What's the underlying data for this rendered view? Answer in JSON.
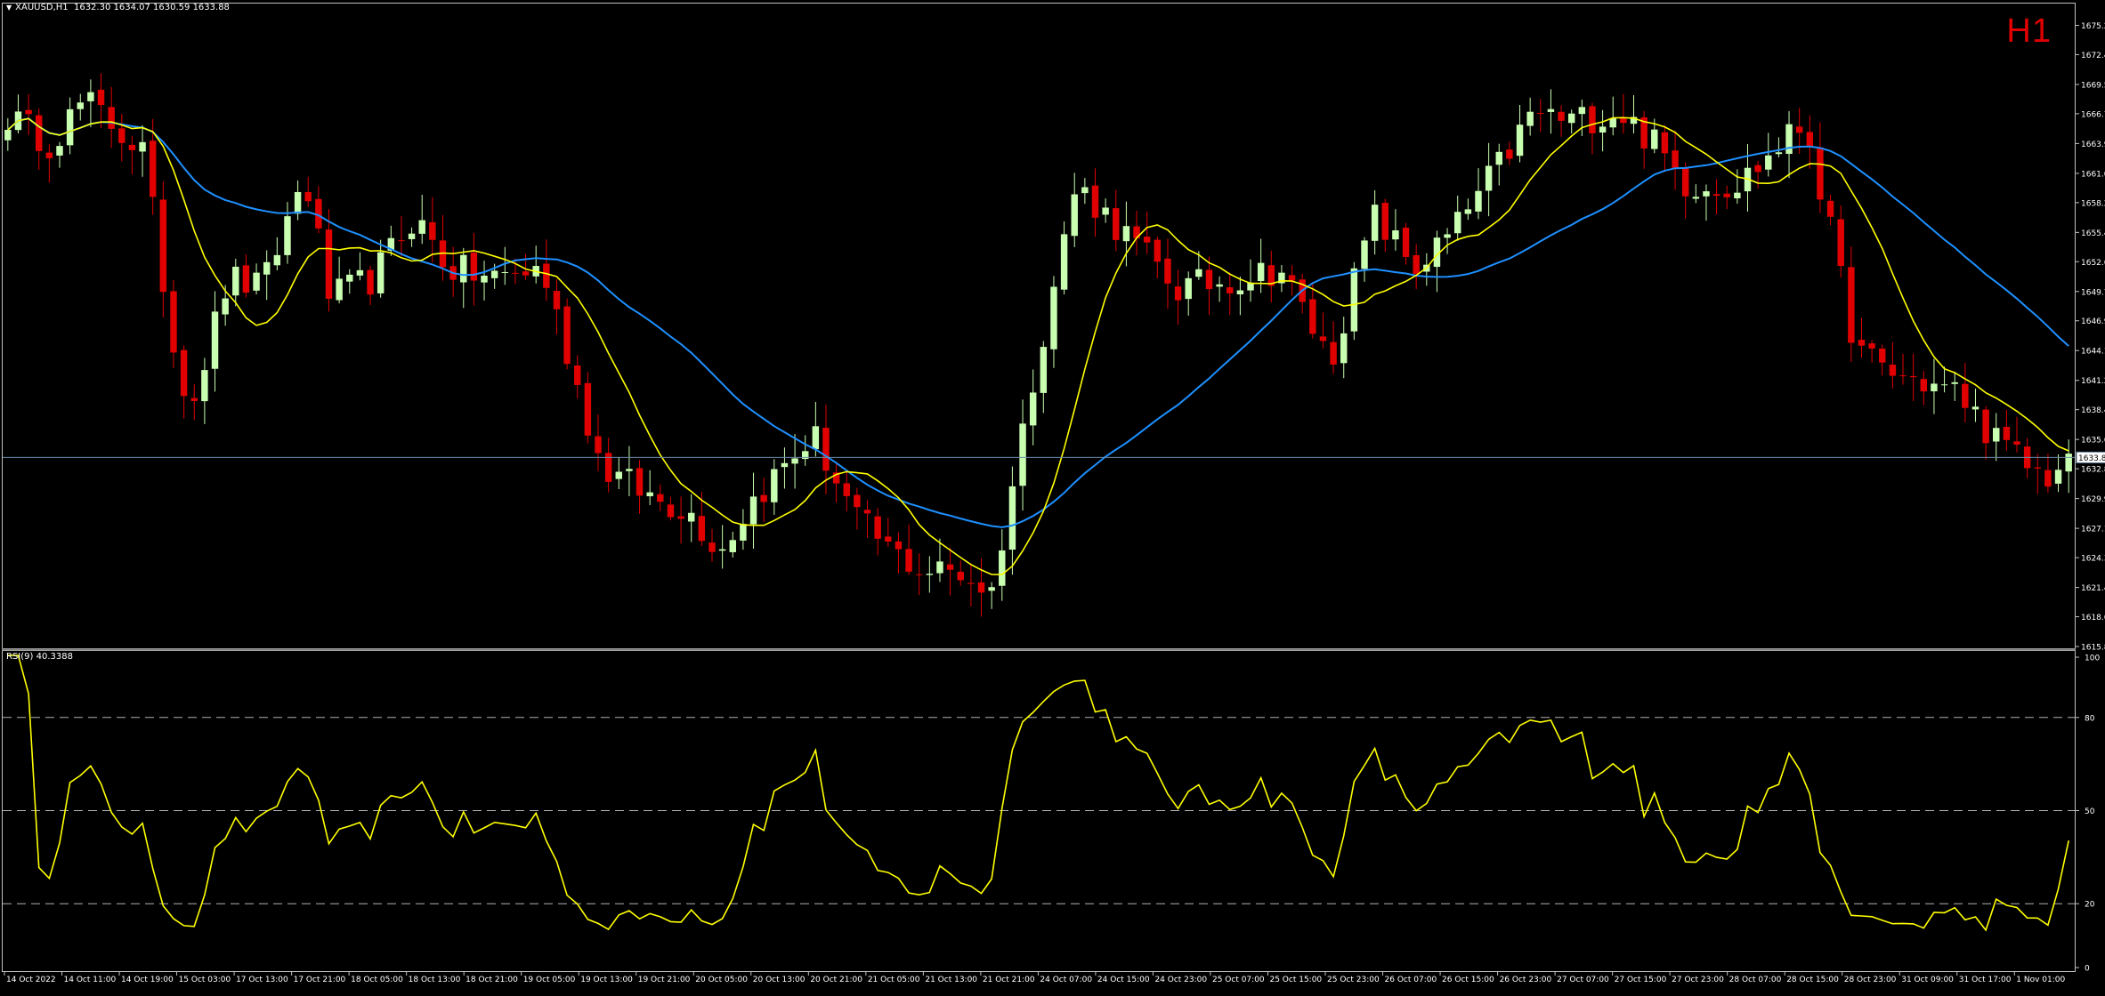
{
  "header": {
    "symbol": "XAUUSD,H1",
    "ohlc": "1632.30 1634.07 1630.59 1633.88"
  },
  "timeframe_badge": "H1",
  "rsi_label": "RSI(9) 40.3388",
  "colors": {
    "bull": "#c8ffb0",
    "bear": "#e00000",
    "ma_fast": "#ffff00",
    "ma_slow": "#1e90ff",
    "rsi": "#ffff00",
    "bid_line": "#6a8aa8"
  },
  "price_axis": {
    "min": 1615.8,
    "max": 1677.2,
    "ticks": [
      "1675.20",
      "1672.40",
      "1669.55",
      "1666.75",
      "1663.90",
      "1661.05",
      "1658.25",
      "1655.40",
      "1652.60",
      "1649.75",
      "1646.95",
      "1644.10",
      "1641.25",
      "1638.45",
      "1635.60",
      "1632.80",
      "1629.95",
      "1627.10",
      "1624.30",
      "1621.45",
      "1618.65",
      "1615.80"
    ],
    "bid": "1633.88"
  },
  "rsi_axis": {
    "ticks": [
      "100",
      "80",
      "50",
      "20",
      "0"
    ],
    "levels": [
      20,
      50,
      80
    ]
  },
  "time_axis": {
    "labels": [
      "14 Oct 2022",
      "14 Oct 11:00",
      "14 Oct 19:00",
      "15 Oct 03:00",
      "17 Oct 13:00",
      "17 Oct 21:00",
      "18 Oct 05:00",
      "18 Oct 13:00",
      "18 Oct 21:00",
      "19 Oct 05:00",
      "19 Oct 13:00",
      "19 Oct 21:00",
      "20 Oct 05:00",
      "20 Oct 13:00",
      "20 Oct 21:00",
      "21 Oct 05:00",
      "21 Oct 13:00",
      "21 Oct 21:00",
      "24 Oct 07:00",
      "24 Oct 15:00",
      "24 Oct 23:00",
      "25 Oct 07:00",
      "25 Oct 15:00",
      "25 Oct 23:00",
      "26 Oct 07:00",
      "26 Oct 15:00",
      "26 Oct 23:00",
      "27 Oct 07:00",
      "27 Oct 15:00",
      "27 Oct 23:00",
      "28 Oct 07:00",
      "28 Oct 15:00",
      "28 Oct 23:00",
      "31 Oct 09:00",
      "31 Oct 17:00",
      "1 Nov 01:00"
    ]
  },
  "chart_data": {
    "type": "candlestick",
    "bars_count": 200,
    "anchors": [
      [
        0,
        1666.5
      ],
      [
        5,
        1664
      ],
      [
        9,
        1668
      ],
      [
        12,
        1666
      ],
      [
        16,
        1663
      ],
      [
        20,
        1642
      ],
      [
        22,
        1640
      ],
      [
        26,
        1651
      ],
      [
        30,
        1650
      ],
      [
        35,
        1661
      ],
      [
        38,
        1649
      ],
      [
        43,
        1651
      ],
      [
        48,
        1657
      ],
      [
        52,
        1652
      ],
      [
        57,
        1651
      ],
      [
        63,
        1652
      ],
      [
        70,
        1633
      ],
      [
        76,
        1630
      ],
      [
        80,
        1629
      ],
      [
        84,
        1625
      ],
      [
        88,
        1630
      ],
      [
        95,
        1636
      ],
      [
        100,
        1628
      ],
      [
        104,
        1625
      ],
      [
        108,
        1623
      ],
      [
        112,
        1623
      ],
      [
        116,
        1621
      ],
      [
        121,
        1642
      ],
      [
        126,
        1660
      ],
      [
        132,
        1655
      ],
      [
        138,
        1650
      ],
      [
        145,
        1651
      ],
      [
        150,
        1652
      ],
      [
        156,
        1643
      ],
      [
        161,
        1657
      ],
      [
        166,
        1652
      ],
      [
        170,
        1655
      ],
      [
        176,
        1662
      ],
      [
        180,
        1667
      ],
      [
        184,
        1666
      ],
      [
        190,
        1667
      ],
      [
        194,
        1664
      ],
      [
        198,
        1660
      ],
      [
        204,
        1660
      ],
      [
        212,
        1666
      ],
      [
        218,
        1644
      ],
      [
        222,
        1642
      ],
      [
        230,
        1640
      ],
      [
        235,
        1635
      ],
      [
        240,
        1632
      ],
      [
        243,
        1633
      ]
    ],
    "ma_fast_period": 10,
    "ma_slow_period": 30,
    "rsi_period": 9,
    "rsi_last": 40.3388
  }
}
